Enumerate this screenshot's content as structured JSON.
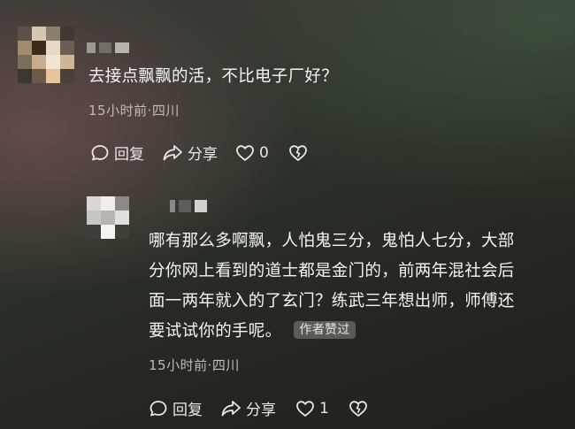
{
  "comments": [
    {
      "text": "去接点飘飘的活，不比电子厂好？",
      "meta": "15小时前·四川",
      "reply_label": "回复",
      "share_label": "分享",
      "like_count": "0"
    },
    {
      "text_lines": [
        "哪有那么多啊飘，人怕鬼三分，鬼怕人七分，大部",
        "分你网上看到的道士都是金门的，前两年混社会后",
        "面一两年就入的了玄门？练武三年想出师，师傅还",
        "要试试你的手呢。"
      ],
      "badge": "作者赞过",
      "meta": "15小时前·四川",
      "reply_label": "回复",
      "share_label": "分享",
      "like_count": "1"
    }
  ],
  "icons": [
    "reply-icon",
    "share-icon",
    "heart-icon",
    "dislike-heart-icon"
  ],
  "colors": {
    "text": "#f5f5f5",
    "meta": "#bdbdb3",
    "badge_bg": "#8a8a84"
  }
}
